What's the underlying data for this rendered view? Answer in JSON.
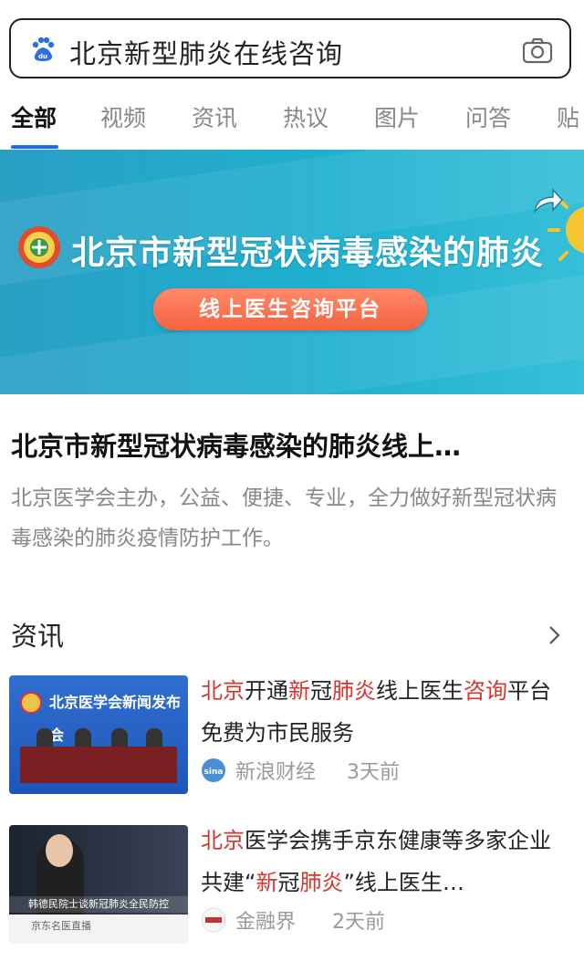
{
  "search": {
    "query": "北京新型肺炎在线咨询"
  },
  "tabs": [
    "全部",
    "视频",
    "资讯",
    "热议",
    "图片",
    "问答",
    "贴"
  ],
  "banner": {
    "headline": "北京市新型冠状病毒感染的肺炎",
    "button": "线上医生咨询平台"
  },
  "result": {
    "title": "北京市新型冠状病毒感染的肺炎线上…",
    "description": "北京医学会主办，公益、便捷、专业，全力做好新型冠状病毒感染的肺炎疫情防护工作。"
  },
  "news_section": {
    "title": "资讯"
  },
  "news": [
    {
      "title_parts": [
        {
          "t": "北京",
          "hl": true
        },
        {
          "t": "开通",
          "hl": false
        },
        {
          "t": "新",
          "hl": true
        },
        {
          "t": "冠",
          "hl": false
        },
        {
          "t": "肺炎",
          "hl": true
        },
        {
          "t": "线上医生",
          "hl": false
        },
        {
          "t": "咨询",
          "hl": true
        },
        {
          "t": "平台 免费为市民服务",
          "hl": false
        }
      ],
      "source": "新浪财经",
      "time": "3天前",
      "thumb_caption": "北京医学会新闻发布会"
    },
    {
      "title_parts": [
        {
          "t": "北京",
          "hl": true
        },
        {
          "t": "医学会携手京东健康等多家企业 共建“",
          "hl": false
        },
        {
          "t": "新",
          "hl": true
        },
        {
          "t": "冠",
          "hl": false
        },
        {
          "t": "肺炎",
          "hl": true
        },
        {
          "t": "”线上医生…",
          "hl": false
        }
      ],
      "source": "金融界",
      "time": "2天前",
      "thumb_caption": "韩德民院士谈新冠肺炎全民防控",
      "thumb_footer": "京东名医直播"
    }
  ],
  "colors": {
    "accent": "#1e6bf0",
    "highlight": "#d9352c",
    "banner": "#24a6c9",
    "pill": "#f4623f"
  }
}
